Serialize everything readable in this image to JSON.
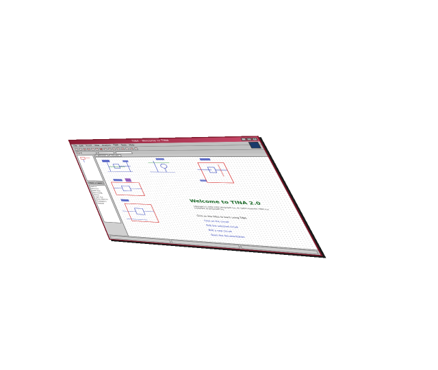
{
  "window": {
    "title": "TINA - Welcome to TINA"
  },
  "menubar": {
    "items": [
      "File",
      "Edit",
      "Insert",
      "View",
      "Analysis",
      "T&M",
      "Tools",
      "Help"
    ]
  },
  "left_panel": {
    "tabs": [
      "Tools",
      "Basic"
    ],
    "list_items": [
      "Meters",
      "Sources",
      "Switches",
      "Semicond.",
      "Gates",
      "Logic ICs",
      "Spice Macros",
      "Transistors",
      "Special"
    ]
  },
  "document_tabs": [
    "Welcome",
    "Circuit1"
  ],
  "welcome": {
    "title": "Welcome to TINA 2.0",
    "copyright": "Copyright (C) 1993-2002 DesignSoft Inc. All rights reserved. TINA is a trademark of DesignSoft Inc.",
    "intro": "Click on the titles to learn using TINA:",
    "links": [
      "Click on the circuit",
      "Edit the selected circuit",
      "Edit a new circuit",
      "Open the documentation"
    ]
  },
  "colors": {
    "title_bar": "#8a1c34",
    "welcome_title": "#1d6a2a",
    "link": "#1a2db0",
    "schematic_label": "#1a2db0",
    "schematic_wire_red": "#d01818"
  }
}
